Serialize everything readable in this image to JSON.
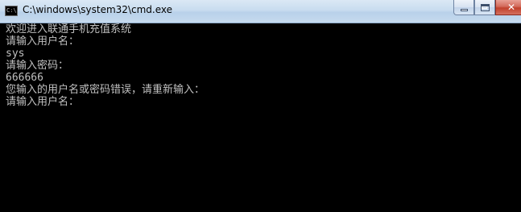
{
  "window": {
    "title": "C:\\windows\\system32\\cmd.exe",
    "icon_name": "cmd-icon",
    "icon_text": "C:\\",
    "buttons": {
      "minimize_icon": "minimize-icon",
      "maximize_icon": "maximize-icon",
      "close_icon": "close-icon",
      "close_glyph": "✕"
    }
  },
  "console": {
    "text_color": "#c0c0c0",
    "background": "#000000",
    "lines": [
      "欢迎进入联通手机充值系统",
      "请输入用户名：",
      "sys",
      "请输入密码：",
      "666666",
      "您输入的用户名或密码错误，请重新输入：",
      "请输入用户名："
    ]
  }
}
